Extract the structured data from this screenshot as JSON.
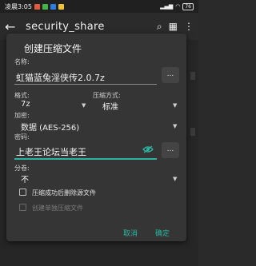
{
  "status": {
    "time": "凌晨3:05",
    "battery": "76",
    "app_colors": [
      "#e35a3f",
      "#46b348",
      "#2b7de0",
      "#f0c23a"
    ]
  },
  "appbar": {
    "title": "security_share",
    "back_icon": "arrow-back-icon",
    "search_icon": "search-icon",
    "grid_icon": "grid-icon",
    "more_icon": "more-vert-icon"
  },
  "dialog": {
    "title": "创建压缩文件",
    "name_label": "名称:",
    "name_value": "虹猫蓝兔淫侠传2.0.7z",
    "name_browse": "...",
    "format_label": "格式:",
    "format_value": "7z",
    "level_label": "压缩方式:",
    "level_value": "标准",
    "encrypt_label": "加密:",
    "encrypt_value": "数据 (AES-256)",
    "password_label": "密码:",
    "password_value": "上老王论坛当老王",
    "password_more": "...",
    "split_label": "分卷:",
    "split_value": "不",
    "delete_source_label": "压缩成功后删除源文件",
    "separate_archives_label": "创建单独压缩文件",
    "cancel": "取消",
    "ok": "确定",
    "accent_color": "#2bb5a0"
  }
}
